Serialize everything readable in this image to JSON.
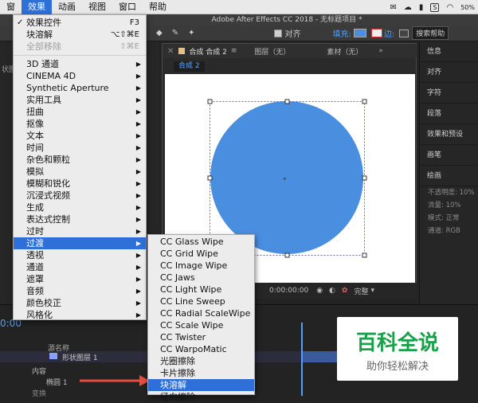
{
  "menubar": {
    "items": [
      "窗",
      "效果",
      "动画",
      "视图",
      "窗口",
      "帮助"
    ],
    "active_index": 1,
    "right_text": "50%"
  },
  "app_title": "Adobe After Effects CC 2018 - 无标题项目 *",
  "toolbar": {
    "align_label": "对齐",
    "fill_label": "填充:",
    "stroke_label": "边:",
    "search_label": "搜索帮助"
  },
  "comp_panel": {
    "tab_label": "合成 合成 2",
    "layer_label": "图层（无）",
    "footage_label": "素材（无）",
    "subtab": "合成 2",
    "timecode": "0:00:00:00",
    "quality": "完整"
  },
  "right_panel": {
    "items": [
      "信息",
      "对齐",
      "字符",
      "段落",
      "效果和预设",
      "画笔",
      "绘画"
    ],
    "paint_props": [
      "不透明度: 10%",
      "流量: 10%",
      "模式: 正常",
      "通道: RGB"
    ]
  },
  "effect_menu": {
    "items": [
      {
        "label": "效果控件",
        "shortcut": "F3",
        "checked": true
      },
      {
        "label": "块溶解",
        "shortcut": "⌥⇧⌘E"
      },
      {
        "label": "全部移除",
        "shortcut": "⇧⌘E",
        "disabled": true
      },
      {
        "sep": true
      },
      {
        "label": "3D 通道",
        "sub": true
      },
      {
        "label": "CINEMA 4D",
        "sub": true
      },
      {
        "label": "Synthetic Aperture",
        "sub": true
      },
      {
        "label": "实用工具",
        "sub": true
      },
      {
        "label": "扭曲",
        "sub": true
      },
      {
        "label": "抠像",
        "sub": true
      },
      {
        "label": "文本",
        "sub": true
      },
      {
        "label": "时间",
        "sub": true
      },
      {
        "label": "杂色和颗粒",
        "sub": true
      },
      {
        "label": "模拟",
        "sub": true
      },
      {
        "label": "模糊和锐化",
        "sub": true
      },
      {
        "label": "沉浸式视频",
        "sub": true
      },
      {
        "label": "生成",
        "sub": true
      },
      {
        "label": "表达式控制",
        "sub": true
      },
      {
        "label": "过时",
        "sub": true
      },
      {
        "label": "过渡",
        "sub": true,
        "highlighted": true
      },
      {
        "label": "透视",
        "sub": true
      },
      {
        "label": "通道",
        "sub": true
      },
      {
        "label": "遮罩",
        "sub": true
      },
      {
        "label": "音频",
        "sub": true
      },
      {
        "label": "颜色校正",
        "sub": true
      },
      {
        "label": "风格化",
        "sub": true
      }
    ]
  },
  "transition_submenu": {
    "items": [
      {
        "label": "CC Glass Wipe"
      },
      {
        "label": "CC Grid Wipe"
      },
      {
        "label": "CC Image Wipe"
      },
      {
        "label": "CC Jaws"
      },
      {
        "label": "CC Light Wipe"
      },
      {
        "label": "CC Line Sweep"
      },
      {
        "label": "CC Radial ScaleWipe"
      },
      {
        "label": "CC Scale Wipe"
      },
      {
        "label": "CC Twister"
      },
      {
        "label": "CC WarpoMatic"
      },
      {
        "label": "光圈擦除"
      },
      {
        "label": "卡片擦除"
      },
      {
        "label": "块溶解",
        "highlighted": true
      },
      {
        "label": "径向擦除"
      }
    ]
  },
  "timeline": {
    "timecode": "0:00",
    "col_source": "源名称",
    "layer_name": "形状图层 1",
    "content_label": "内容",
    "shape_label": "椭圆 1",
    "transform_label": "变换"
  },
  "shape": {
    "fill": "#4a8ee0"
  },
  "watermark": {
    "title": "百科全说",
    "subtitle": "助你轻松解决"
  }
}
